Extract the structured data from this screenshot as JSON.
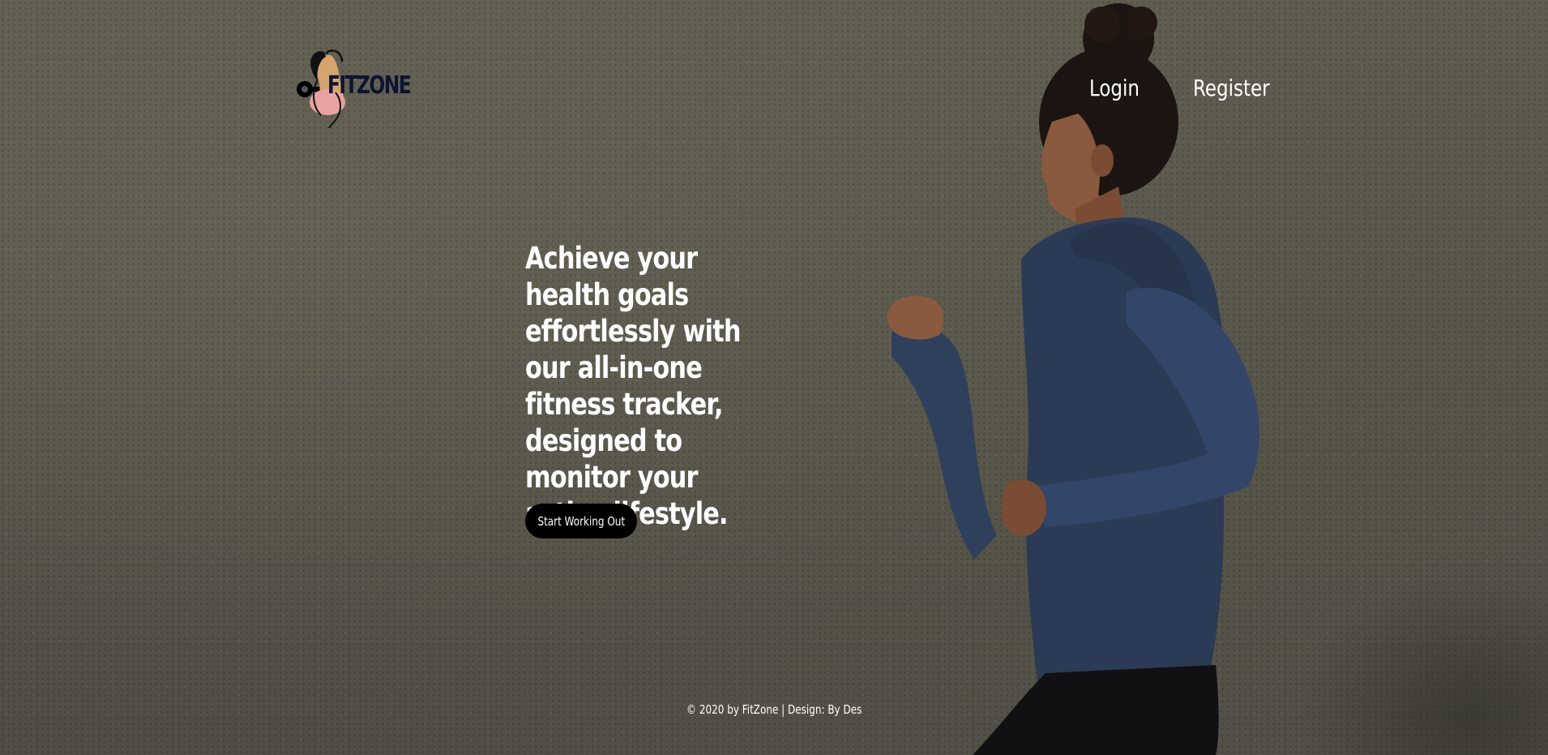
{
  "header": {
    "logo_text": "FITZONE",
    "nav": {
      "login": "Login",
      "register": "Register"
    }
  },
  "hero": {
    "title": "Achieve your health goals effortlessly with our all-in-one fitness tracker, designed to monitor your active lifestyle.",
    "cta_label": "Start Working Out"
  },
  "footer": {
    "text": "© 2020 by FitZone | Design: By Des"
  },
  "colors": {
    "cta_background": "#000000",
    "text": "#ffffff",
    "logo_text": "#0d1433",
    "jacket": "#2b3b55"
  },
  "icons": {
    "logo": "fitness-woman-dumbbell-logo"
  }
}
